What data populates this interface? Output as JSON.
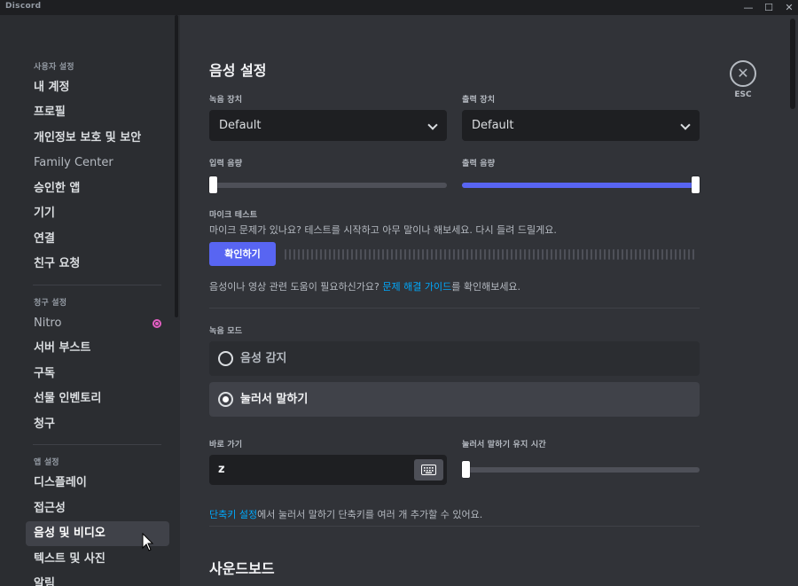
{
  "window": {
    "app_name": "Discord"
  },
  "sidebar": {
    "user_header": "사용자 설정",
    "user_items": [
      {
        "label": "내 계정"
      },
      {
        "label": "프로필"
      },
      {
        "label": "개인정보 보호 및 보안"
      },
      {
        "label": "Family Center"
      },
      {
        "label": "승인한 앱"
      },
      {
        "label": "기기"
      },
      {
        "label": "연결"
      },
      {
        "label": "친구 요청"
      }
    ],
    "billing_header": "청구 설정",
    "billing_items": [
      {
        "label": "Nitro"
      },
      {
        "label": "서버 부스트"
      },
      {
        "label": "구독"
      },
      {
        "label": "선물 인벤토리"
      },
      {
        "label": "청구"
      }
    ],
    "app_header": "앱 설정",
    "app_items": [
      {
        "label": "디스플레이"
      },
      {
        "label": "접근성"
      },
      {
        "label": "음성 및 비디오"
      },
      {
        "label": "텍스트 및 사진"
      },
      {
        "label": "알림"
      }
    ]
  },
  "main": {
    "title": "음성 설정",
    "esc_label": "ESC",
    "input_device": {
      "label": "녹음 장치",
      "value": "Default"
    },
    "output_device": {
      "label": "출력 장치",
      "value": "Default"
    },
    "input_volume": {
      "label": "입력 음량",
      "level": 0.0
    },
    "output_volume": {
      "label": "출력 음량",
      "level": 1.0
    },
    "mic_test": {
      "label": "마이크 테스트",
      "description": "마이크 문제가 있나요? 테스트를 시작하고 아무 말이나 해보세요. 다시 들려 드릴게요.",
      "button": "확인하기"
    },
    "help": {
      "prefix": "음성이나 영상 관련 도움이 필요하신가요? ",
      "link": "문제 해결 가이드",
      "suffix": "를 확인해보세요."
    },
    "input_mode": {
      "label": "녹음 모드",
      "options": [
        {
          "label": "음성 감지",
          "selected": false
        },
        {
          "label": "눌러서 말하기",
          "selected": true
        }
      ]
    },
    "shortcut": {
      "label": "바로 가기",
      "value": "z"
    },
    "ptt_delay": {
      "label": "눌러서 말하기 유지 시간",
      "level": 0.0
    },
    "keybind_note": {
      "link": "단축키 설정",
      "suffix": "에서 눌러서 말하기 단축키를 여러 개 추가할 수 있어요."
    },
    "soundboard_title": "사운드보드"
  },
  "colors": {
    "accent": "#5865f2",
    "link": "#00a8fc",
    "nitro": "#e35ec2"
  }
}
